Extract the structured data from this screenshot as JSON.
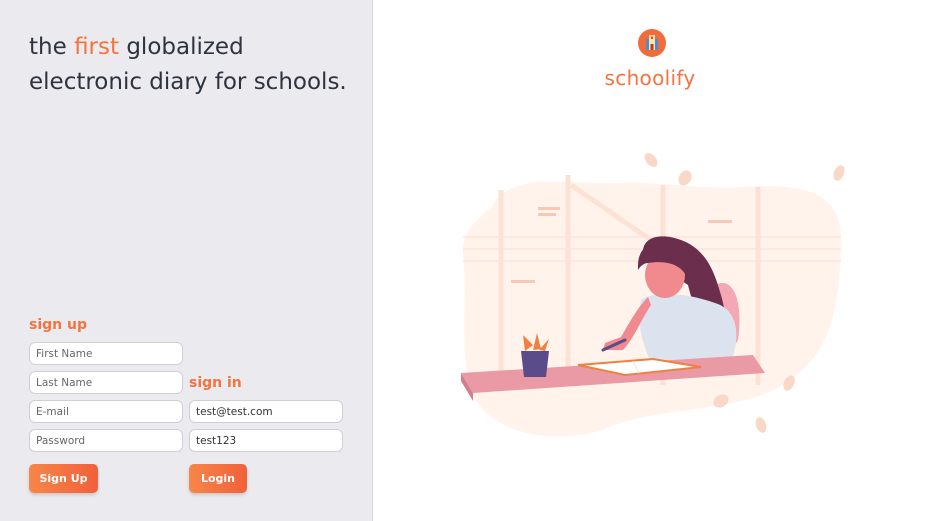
{
  "tagline": {
    "before": "the ",
    "accent": "first",
    "after": " globalized electronic diary for schools."
  },
  "signup": {
    "title": "sign up",
    "first_name_placeholder": "First Name",
    "last_name_placeholder": "Last Name",
    "email_placeholder": "E-mail",
    "password_placeholder": "Password",
    "button_label": "Sign Up"
  },
  "signin": {
    "title": "sign in",
    "email_value": "test@test.com",
    "password_value": "test123",
    "button_label": "Login"
  },
  "brand": {
    "name": "schoolify",
    "logo_icon": "school-building-icon",
    "accent_color": "#f5733e"
  },
  "illustration": {
    "icon": "student-writing-at-desk-illustration"
  }
}
